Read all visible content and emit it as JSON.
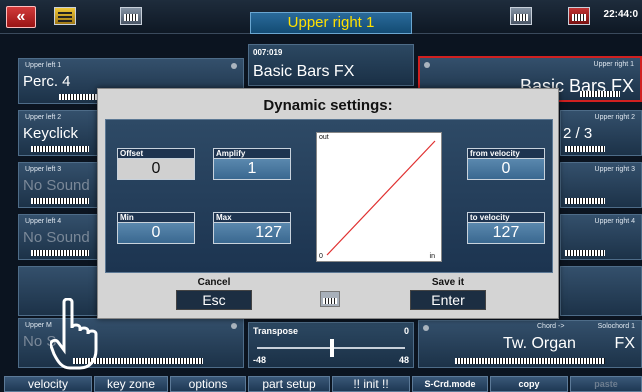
{
  "header": {
    "back_label": "«",
    "title": "Upper right 1",
    "clock": "22:44:0",
    "icons": [
      "back-icon",
      "menu-icon",
      "keyboard-icon",
      "split-icon",
      "shift-icon"
    ]
  },
  "panels": {
    "ul1": {
      "label": "Upper left 1",
      "name": "Perc. 4"
    },
    "ul2": {
      "label": "Upper left 2",
      "name": "Keyclick"
    },
    "ul3": {
      "label": "Upper left 3",
      "name": "No Sound"
    },
    "ul4": {
      "label": "Upper left 4",
      "name": "No Sound"
    },
    "um": {
      "label": "Upper M",
      "name": "No S"
    },
    "ur1": {
      "label": "Upper right 1",
      "name": "Basic Bars   FX"
    },
    "ur2": {
      "label": "Upper right 2",
      "name": "2 / 3"
    },
    "ur3": {
      "label": "Upper right 3"
    },
    "ur4": {
      "label": "Upper right 4"
    }
  },
  "program": {
    "number": "007:019",
    "name": "Basic Bars   FX"
  },
  "transpose": {
    "label": "Transpose",
    "value": "0",
    "min": "-48",
    "max": "48",
    "position_fraction": 0.5
  },
  "chord": {
    "label_left": "Chord ->",
    "label_right": "Solochord 1",
    "name": "Tw. Organ",
    "fx": "FX"
  },
  "bottom_buttons": [
    {
      "label": "velocity"
    },
    {
      "label": "key zone"
    },
    {
      "label": "options"
    },
    {
      "label": "part setup"
    },
    {
      "label": "!! init !!"
    },
    {
      "label": "S-Crd.mode"
    },
    {
      "label": "copy"
    },
    {
      "label": "paste"
    }
  ],
  "dialog": {
    "title": "Dynamic settings:",
    "offset": {
      "label": "Offset",
      "value": "0"
    },
    "amplify": {
      "label": "Amplify",
      "value": "1"
    },
    "min": {
      "label": "Min",
      "value": "0"
    },
    "max": {
      "label": "Max",
      "value": "127"
    },
    "from_velocity": {
      "label": "from velocity",
      "value": "0"
    },
    "to_velocity": {
      "label": "to velocity",
      "value": "127"
    },
    "graph": {
      "out_label": "out",
      "zero_label": "0",
      "in_label": "in",
      "line_color": "#e03030"
    },
    "cancel": {
      "label": "Cancel",
      "button": "Esc"
    },
    "save": {
      "label": "Save it",
      "button": "Enter"
    }
  }
}
